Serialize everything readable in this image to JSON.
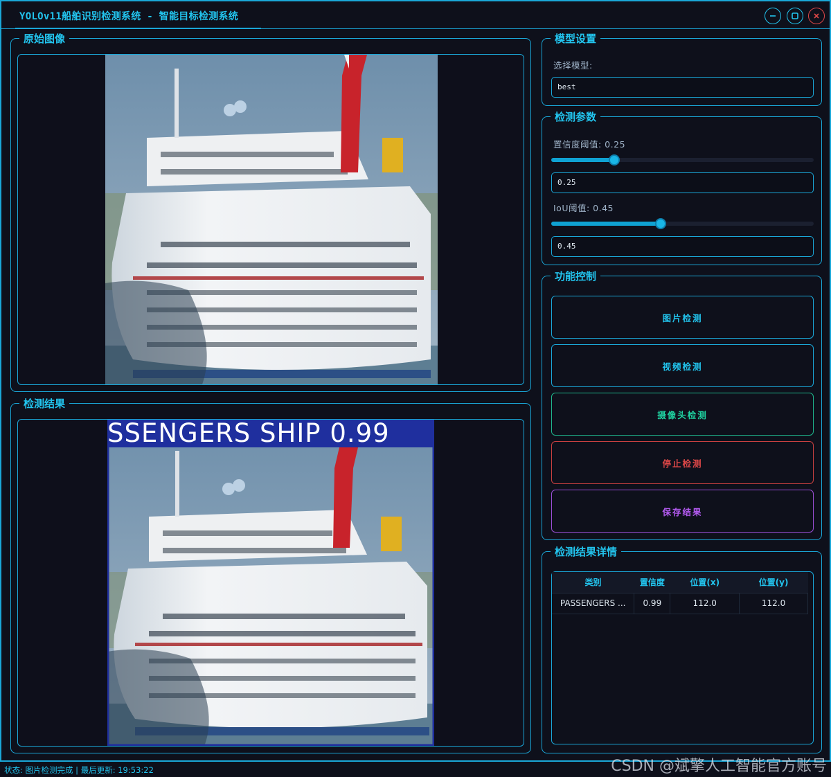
{
  "window": {
    "title": "YOLOv11船舶识别检测系统 - 智能目标检测系统"
  },
  "original_panel": {
    "title": "原始图像"
  },
  "result_panel": {
    "title": "检测结果",
    "box_label": "SSENGERS SHIP 0.99"
  },
  "model_settings": {
    "title": "模型设置",
    "select_label": "选择模型:",
    "model_value": "best"
  },
  "detect_params": {
    "title": "检测参数",
    "conf_label": "置信度阈值: 0.25",
    "conf_value": "0.25",
    "conf_fraction": 0.25,
    "iou_label": "IoU阈值: 0.45",
    "iou_value": "0.45",
    "iou_fraction": 0.45
  },
  "function_control": {
    "title": "功能控制",
    "image_detect": "图片检测",
    "video_detect": "视频检测",
    "camera_detect": "摄像头检测",
    "stop_detect": "停止检测",
    "save_result": "保存结果"
  },
  "details": {
    "title": "检测结果详情",
    "columns": [
      "类别",
      "置信度",
      "位置(x)",
      "位置(y)"
    ],
    "rows": [
      [
        "PASSENGERS ...",
        "0.99",
        "112.0",
        "112.0"
      ]
    ]
  },
  "status": {
    "text": "状态: 图片检测完成 | 最后更新: 19:53:22"
  },
  "watermark": "CSDN @斌擎人工智能官方账号",
  "colors": {
    "accent": "#22c4ee",
    "background": "#0e101b",
    "stop": "#e04848",
    "camera": "#1fd1a0",
    "save": "#b45bf2",
    "detection_box": "#1f2f9e"
  },
  "icons": [
    "minimize-icon",
    "maximize-icon",
    "close-icon"
  ]
}
